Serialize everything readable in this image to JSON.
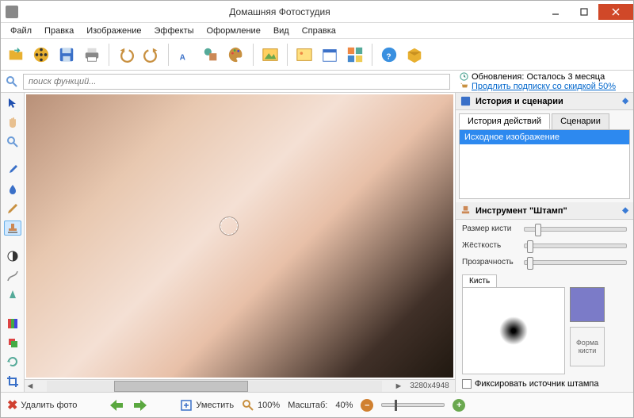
{
  "titlebar": {
    "title": "Домашняя Фотостудия"
  },
  "menu": [
    "Файл",
    "Правка",
    "Изображение",
    "Эффекты",
    "Оформление",
    "Вид",
    "Справка"
  ],
  "search": {
    "placeholder": "поиск функций..."
  },
  "updates": {
    "line1": "Обновления: Осталось  3 месяца",
    "line2": "Продлить подписку со скидкой 50%"
  },
  "panels": {
    "history_title": "История и сценарии",
    "tabs": {
      "history": "История действий",
      "scenarios": "Сценарии"
    },
    "history_item": "Исходное изображение",
    "tool_title": "Инструмент \"Штамп\"",
    "props": {
      "size": "Размер кисти",
      "hardness": "Жёсткость",
      "opacity": "Прозрачность"
    },
    "brush_tab": "Кисть",
    "shape_btn": "Форма кисти",
    "fix_source": "Фиксировать источник штампа"
  },
  "status": {
    "delete": "Удалить фото",
    "fit": "Уместить",
    "zoom100": "100%",
    "scale_label": "Масштаб:",
    "scale_value": "40%",
    "dimensions": "3280x4948"
  },
  "colors": {
    "accent": "#2d89ef",
    "swatch": "#7b7bc8",
    "close": "#d04828"
  }
}
